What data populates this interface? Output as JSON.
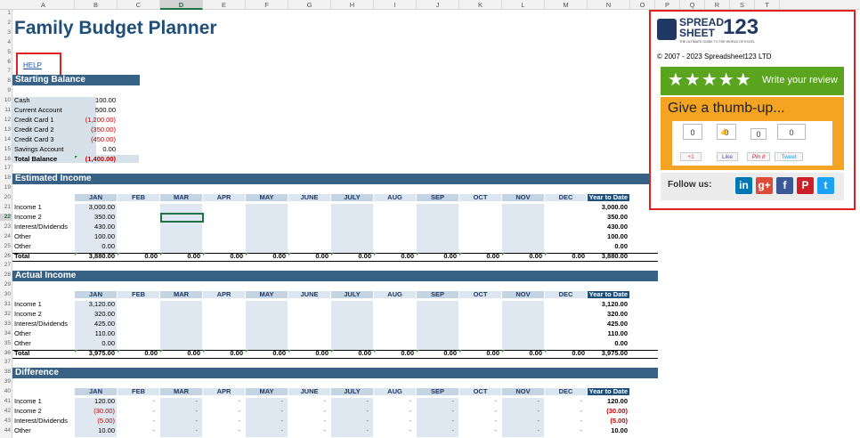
{
  "columns": [
    "A",
    "B",
    "C",
    "D",
    "E",
    "F",
    "G",
    "H",
    "I",
    "J",
    "K",
    "L",
    "M",
    "N",
    "O",
    "P",
    "Q",
    "R",
    "S",
    "T"
  ],
  "selected_column": "D",
  "selected_row": "22",
  "rows": [
    "1",
    "2",
    "3",
    "4",
    "5",
    "6",
    "7",
    "8",
    "9",
    "10",
    "11",
    "12",
    "13",
    "14",
    "15",
    "16",
    "17",
    "18",
    "19",
    "20",
    "21",
    "22",
    "23",
    "24",
    "25",
    "26",
    "27",
    "28",
    "29",
    "30",
    "31",
    "32",
    "33",
    "34",
    "35",
    "36",
    "37",
    "38",
    "39",
    "40",
    "41",
    "42",
    "43",
    "44"
  ],
  "title": "Family Budget Planner",
  "help_link": "HELP",
  "starting_balance": {
    "heading": "Starting Balance",
    "items": [
      {
        "label": "Cash",
        "value": "100.00",
        "neg": false
      },
      {
        "label": "Current Account",
        "value": "500.00",
        "neg": false
      },
      {
        "label": "Credit Card 1",
        "value": "(1,200.00)",
        "neg": true
      },
      {
        "label": "Credit Card 2",
        "value": "(350.00)",
        "neg": true
      },
      {
        "label": "Credit Card 3",
        "value": "(450.00)",
        "neg": true
      },
      {
        "label": "Savings Account",
        "value": "0.00",
        "neg": false
      }
    ],
    "total_label": "Total Balance",
    "total_value": "(1,400.00)"
  },
  "months": [
    "JAN",
    "FEB",
    "MAR",
    "APR",
    "MAY",
    "JUNE",
    "JULY",
    "AUG",
    "SEP",
    "OCT",
    "NOV",
    "DEC",
    "Year to Date"
  ],
  "estimated_income": {
    "heading": "Estimated Income",
    "rows": [
      {
        "label": "Income 1",
        "jan": "3,000.00",
        "ytd": "3,000.00"
      },
      {
        "label": "Income 2",
        "jan": "350.00",
        "ytd": "350.00"
      },
      {
        "label": "Interest/Dividends",
        "jan": "430.00",
        "ytd": "430.00"
      },
      {
        "label": "Other",
        "jan": "100.00",
        "ytd": "100.00"
      },
      {
        "label": "Other",
        "jan": "0.00",
        "ytd": "0.00"
      }
    ],
    "total_label": "Total",
    "totals": [
      "3,880.00",
      "0.00",
      "0.00",
      "0.00",
      "0.00",
      "0.00",
      "0.00",
      "0.00",
      "0.00",
      "0.00",
      "0.00",
      "0.00",
      "3,880.00"
    ]
  },
  "actual_income": {
    "heading": "Actual Income",
    "rows": [
      {
        "label": "Income 1",
        "jan": "3,120.00",
        "ytd": "3,120.00"
      },
      {
        "label": "Income 2",
        "jan": "320.00",
        "ytd": "320.00"
      },
      {
        "label": "Interest/Dividends",
        "jan": "425.00",
        "ytd": "425.00"
      },
      {
        "label": "Other",
        "jan": "110.00",
        "ytd": "110.00"
      },
      {
        "label": "Other",
        "jan": "0.00",
        "ytd": "0.00"
      }
    ],
    "total_label": "Total",
    "totals": [
      "3,975.00",
      "0.00",
      "0.00",
      "0.00",
      "0.00",
      "0.00",
      "0.00",
      "0.00",
      "0.00",
      "0.00",
      "0.00",
      "0.00",
      "3,975.00"
    ]
  },
  "difference": {
    "heading": "Difference",
    "dash": "-",
    "rows": [
      {
        "label": "Income 1",
        "jan": "120.00",
        "ytd": "120.00",
        "neg": false
      },
      {
        "label": "Income 2",
        "jan": "(30.00)",
        "ytd": "(30.00)",
        "neg": true
      },
      {
        "label": "Interest/Dividends",
        "jan": "(5.00)",
        "ytd": "(5.00)",
        "neg": true
      },
      {
        "label": "Other",
        "jan": "10.00",
        "ytd": "10.00",
        "neg": false
      }
    ]
  },
  "panel": {
    "logo_top": "SPREAD",
    "logo_bottom": "SHEET",
    "logo_num": "123",
    "logo_tagline": "THE ULTIMATE GUIDE TO THE WORLD OF EXCEL",
    "copyright": "© 2007 - 2023 Spreadsheet123 LTD",
    "stars": "★★★★★",
    "review": "Write your review",
    "thumb": "Give a thumb-up...",
    "counts": [
      "0",
      "0",
      "0",
      "0"
    ],
    "gplus": "+1",
    "like": "Like",
    "pinit": "Pin it",
    "tweet": "Tweet",
    "follow": "Follow us:",
    "social_icons": [
      "in",
      "g+",
      "f",
      "P",
      "t"
    ]
  },
  "colors": {
    "header": "#1f4e79",
    "bar": "#376185",
    "negative": "#c00000",
    "accent": "#217346"
  }
}
